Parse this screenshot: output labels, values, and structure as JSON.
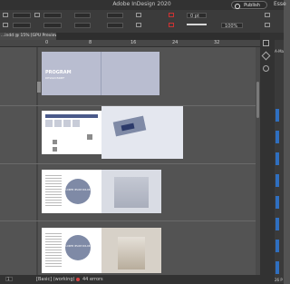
{
  "app": {
    "title": "Adobe InDesign 2020",
    "publish_label": "Publish Online",
    "workspace_label": "Esse"
  },
  "control": {
    "font_size": "0 pt",
    "zoom": "100%",
    "ref_label": "A",
    "stroke_label": "T"
  },
  "document": {
    "tab_label": "...indd @ 15% [GPU Preview]"
  },
  "ruler": {
    "ticks": [
      "0",
      "8",
      "16",
      "24",
      "32"
    ]
  },
  "spreads": {
    "cover_title": "PROGRAM",
    "cover_subtitle": "DESIGN BRIEF",
    "circle_texts": [
      "LOREM IPSUM DOLOR",
      "LOREM IPSUM DOLOR"
    ]
  },
  "status": {
    "page": "1",
    "style": "[Basic] (working)",
    "errors": "44 errors",
    "accent_error": "#d84343"
  },
  "right_panel": {
    "pages_label": "A-Ma",
    "page_count": "26 P"
  }
}
